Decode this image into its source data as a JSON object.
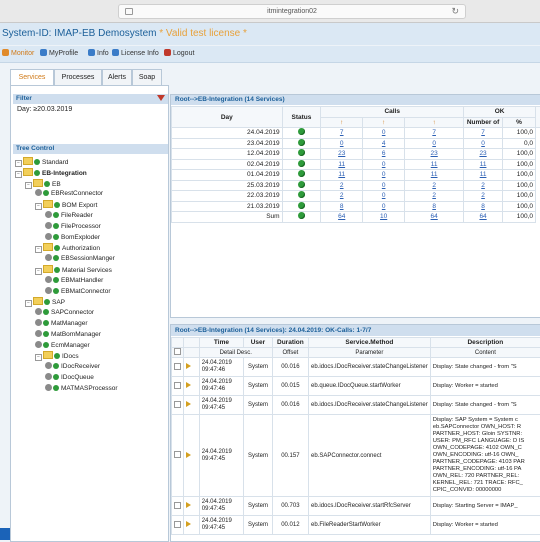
{
  "browser": {
    "url": "itmintegration02"
  },
  "header": {
    "system_id": "System-ID: IMAP-EB Demosystem",
    "license": "* Valid test license *"
  },
  "menu": [
    {
      "label": "Monitor",
      "icon": "monitor-icon",
      "color": "#e08a2a",
      "active": true
    },
    {
      "label": "MyProfile",
      "icon": "profile-icon",
      "color": "#3a7cc8",
      "active": false
    },
    {
      "label": "Info",
      "icon": "info-icon",
      "color": "#3a7cc8",
      "active": false
    },
    {
      "label": "License Info",
      "icon": "license-icon",
      "color": "#3a7cc8",
      "active": false
    },
    {
      "label": "Logout",
      "icon": "logout-icon",
      "color": "#c0392b",
      "active": false
    }
  ],
  "tabs": [
    "Services",
    "Processes",
    "Alerts",
    "Soap"
  ],
  "filter": {
    "title": "Filter",
    "day": "Day: ≥20.03.2019"
  },
  "tree": {
    "title": "Tree Control",
    "nodes": [
      {
        "label": "Standard",
        "type": "folder",
        "level": 0
      },
      {
        "label": "EB-Integration",
        "type": "folder",
        "level": 0,
        "bold": true
      },
      {
        "label": "EB",
        "type": "folder",
        "level": 1
      },
      {
        "label": "EBRestConnector",
        "type": "gear",
        "level": 2
      },
      {
        "label": "BOM Export",
        "type": "folder",
        "level": 2
      },
      {
        "label": "FileReader",
        "type": "gear",
        "level": 3
      },
      {
        "label": "FileProcessor",
        "type": "gear",
        "level": 3
      },
      {
        "label": "BomExploder",
        "type": "gear",
        "level": 3
      },
      {
        "label": "Authorization",
        "type": "folder",
        "level": 2
      },
      {
        "label": "EBSessionManger",
        "type": "gear",
        "level": 3
      },
      {
        "label": "Material Services",
        "type": "folder",
        "level": 2
      },
      {
        "label": "EBMatHandler",
        "type": "gear",
        "level": 3
      },
      {
        "label": "EBMatConnector",
        "type": "gear",
        "level": 3
      },
      {
        "label": "SAP",
        "type": "folder",
        "level": 1
      },
      {
        "label": "SAPConnector",
        "type": "gear",
        "level": 2
      },
      {
        "label": "MatManager",
        "type": "gear",
        "level": 2
      },
      {
        "label": "MatBomManager",
        "type": "gear",
        "level": 2
      },
      {
        "label": "EcmManager",
        "type": "gear",
        "level": 2
      },
      {
        "label": "IDocs",
        "type": "folder",
        "level": 2
      },
      {
        "label": "IDocReceiver",
        "type": "gear",
        "level": 3
      },
      {
        "label": "IDocQueue",
        "type": "gear",
        "level": 3
      },
      {
        "label": "MATMASProcessor",
        "type": "gear",
        "level": 3
      }
    ]
  },
  "calls_panel": {
    "title": "Root-->EB-Integration (14 Services)",
    "headers": {
      "day": "Day",
      "status": "Status",
      "calls": "Calls",
      "ok": "OK",
      "number_of": "Number of",
      "percent": "%"
    },
    "rows": [
      {
        "day": "24.04.2019",
        "c1": "7",
        "c2": "0",
        "c3": "7",
        "n": "7",
        "pct": "100,0"
      },
      {
        "day": "23.04.2019",
        "c1": "0",
        "c2": "4",
        "c3": "0",
        "n": "0",
        "pct": "0,0"
      },
      {
        "day": "12.04.2019",
        "c1": "23",
        "c2": "6",
        "c3": "23",
        "n": "23",
        "pct": "100,0"
      },
      {
        "day": "02.04.2019",
        "c1": "11",
        "c2": "0",
        "c3": "11",
        "n": "11",
        "pct": "100,0"
      },
      {
        "day": "01.04.2019",
        "c1": "11",
        "c2": "0",
        "c3": "11",
        "n": "11",
        "pct": "100,0"
      },
      {
        "day": "25.03.2019",
        "c1": "2",
        "c2": "0",
        "c3": "2",
        "n": "2",
        "pct": "100,0"
      },
      {
        "day": "22.03.2019",
        "c1": "2",
        "c2": "0",
        "c3": "2",
        "n": "2",
        "pct": "100,0"
      },
      {
        "day": "21.03.2019",
        "c1": "8",
        "c2": "0",
        "c3": "8",
        "n": "8",
        "pct": "100,0"
      },
      {
        "day": "Sum",
        "c1": "64",
        "c2": "10",
        "c3": "64",
        "n": "64",
        "pct": "100,0"
      }
    ]
  },
  "log_panel": {
    "title": "Root-->EB-Integration (14 Services): 24.04.2019: OK-Calls: 1-7/7",
    "headers": {
      "time": "Time",
      "user": "User",
      "duration": "Duration",
      "method": "Service.Method",
      "description": "Description"
    },
    "subheaders": {
      "detail": "Detail Desc.",
      "offset": "Offset",
      "parameter": "Parameter",
      "content": "Content"
    },
    "rows": [
      {
        "time": "24.04.2019\n09:47:46",
        "user": "System",
        "duration": "00.016",
        "method": "eb.idocs.IDocReceiver.stateChangeListener",
        "desc": "Display: State changed - from \"S"
      },
      {
        "time": "24.04.2019\n09:47:46",
        "user": "System",
        "duration": "00.015",
        "method": "eb.queue.IDocQueue.startWorker",
        "desc": "Display: Worker = started"
      },
      {
        "time": "24.04.2019\n09:47:45",
        "user": "System",
        "duration": "00.016",
        "method": "eb.idocs.IDocReceiver.stateChangeListener",
        "desc": "Display: State changed - from \"S"
      },
      {
        "time": "24.04.2019\n09:47:45",
        "user": "System",
        "duration": "00.157",
        "method": "eb.SAPConnector.connect",
        "desc": "Display: SAP System = System c\neb.SAPConnector OWN_HOST: R\nPARTNER_HOST: Gloin SYSTNR:\nUSER: PM_RFC LANGUAGE: D IS\nOWN_CODEPAGE: 4102 OWN_C\nOWN_ENCODING: utf-16 OWN_\nPARTNER_CODEPAGE: 4103 PAR\nPARTNER_ENCODING: utf-16 PA\nOWN_REL: 720 PARTNER_REL:\nKERNEL_REL: 721 TRACE: RFC_\nCPIC_CONVID: 00000000"
      },
      {
        "time": "24.04.2019\n09:47:45",
        "user": "System",
        "duration": "00.703",
        "method": "eb.idocs.IDocReceiver.startRfcServer",
        "desc": "Display: Starting Server = IMAP_"
      },
      {
        "time": "24.04.2019\n09:47:45",
        "user": "System",
        "duration": "00.012",
        "method": "eb.FileReaderStartWorker",
        "desc": "Display: Worker = started"
      }
    ]
  }
}
